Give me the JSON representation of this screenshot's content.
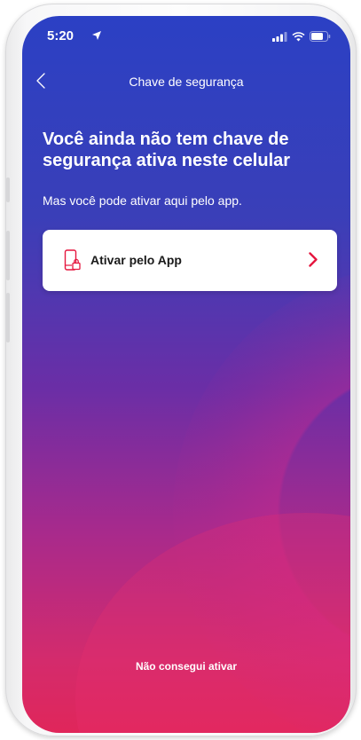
{
  "status_bar": {
    "time": "5:20",
    "icons": [
      "location-arrow-icon",
      "cellular-signal-icon",
      "wifi-icon",
      "battery-icon"
    ]
  },
  "nav": {
    "back_icon": "chevron-left-icon",
    "title": "Chave de segurança"
  },
  "main": {
    "headline": "Você ainda não tem chave de segurança ativa neste celular",
    "subtitle": "Mas você pode ativar aqui pelo app.",
    "action_card": {
      "icon": "phone-lock-icon",
      "label": "Ativar pelo App",
      "chevron_icon": "chevron-right-icon"
    },
    "footer_link": "Não consegui ativar"
  },
  "colors": {
    "accent": "#e5173f",
    "gradient_top": "#2b40c4",
    "gradient_bottom": "#e0265a",
    "text_light": "#ffffff"
  }
}
